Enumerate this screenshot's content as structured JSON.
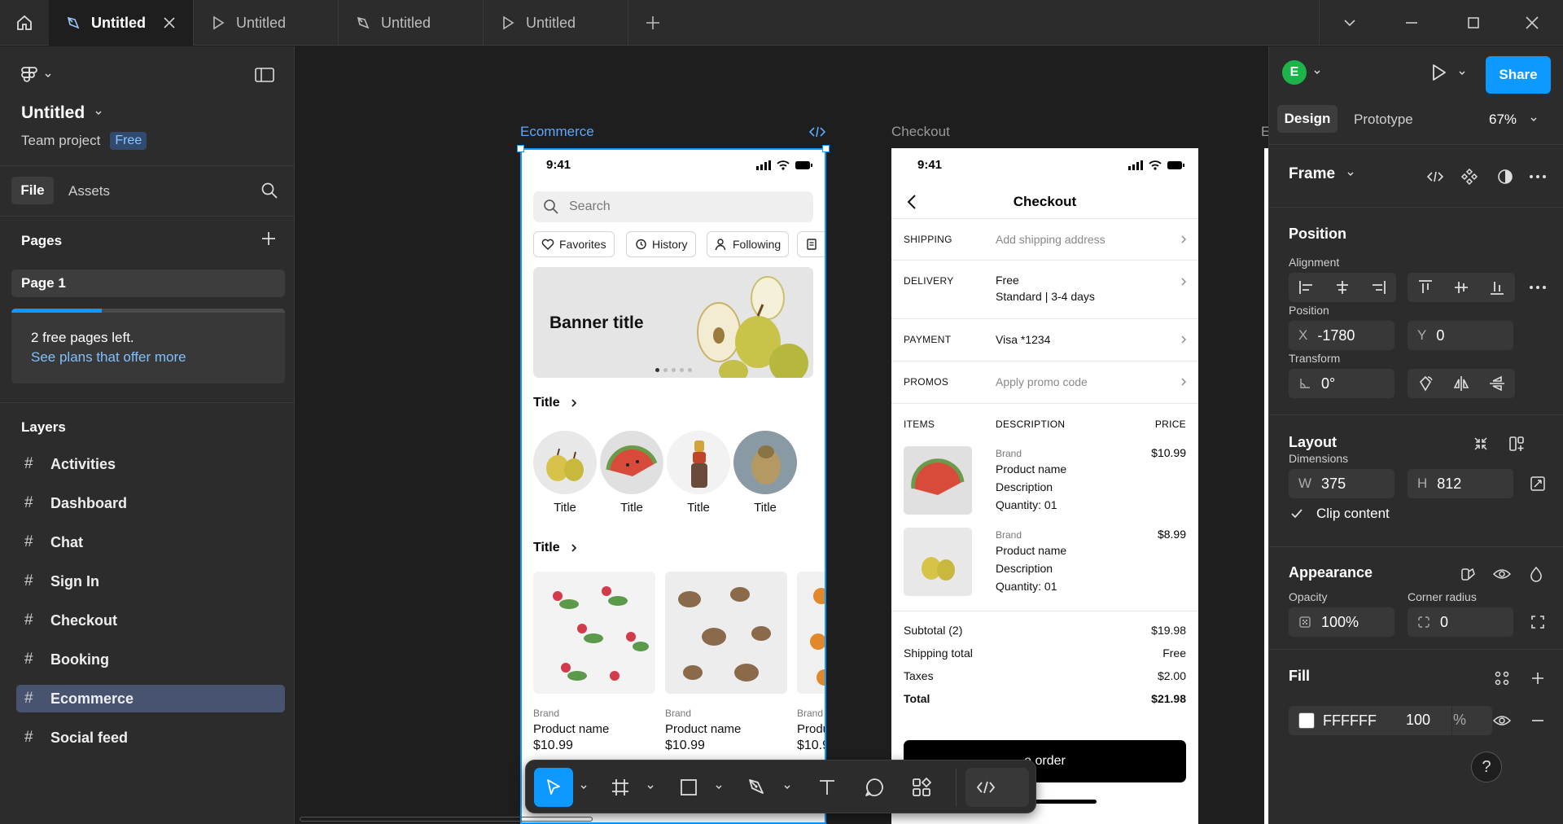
{
  "tabs": [
    {
      "label": "Untitled",
      "icon": "design-file-icon",
      "active": true
    },
    {
      "label": "Untitled",
      "icon": "play-file-icon"
    },
    {
      "label": "Untitled",
      "icon": "design-file-icon"
    },
    {
      "label": "Untitled",
      "icon": "play-file-icon"
    }
  ],
  "file": {
    "title": "Untitled",
    "project": "Team project",
    "plan_badge": "Free"
  },
  "panel_tabs": {
    "file": "File",
    "assets": "Assets"
  },
  "pages": {
    "heading": "Pages",
    "items": [
      "Page 1"
    ],
    "notice": "2 free pages left.",
    "notice_link": "See plans that offer more",
    "usage_fraction": 0.33
  },
  "layers": {
    "heading": "Layers",
    "items": [
      "Activities",
      "Dashboard",
      "Chat",
      "Sign In",
      "Checkout",
      "Booking",
      "Ecommerce",
      "Social feed"
    ],
    "selected": "Ecommerce"
  },
  "canvas": {
    "ecommerce": {
      "label": "Ecommerce",
      "time": "9:41",
      "search_placeholder": "Search",
      "chips": [
        "Favorites",
        "History",
        "Following"
      ],
      "banner_title": "Banner title",
      "section1_title": "Title",
      "circles": [
        "Title",
        "Title",
        "Title",
        "Title"
      ],
      "section2_title": "Title",
      "products": [
        {
          "brand": "Brand",
          "name": "Product name",
          "price": "$10.99"
        },
        {
          "brand": "Brand",
          "name": "Product name",
          "price": "$10.99"
        },
        {
          "brand": "Brand",
          "name": "Produ",
          "price": "$10.9"
        }
      ]
    },
    "checkout": {
      "label": "Checkout",
      "time": "9:41",
      "title": "Checkout",
      "shipping": {
        "key": "SHIPPING",
        "value": "Add shipping address"
      },
      "delivery": {
        "key": "DELIVERY",
        "value1": "Free",
        "value2": "Standard | 3-4 days"
      },
      "payment": {
        "key": "PAYMENT",
        "value": "Visa *1234"
      },
      "promos": {
        "key": "PROMOS",
        "value": "Apply promo code"
      },
      "items_header": {
        "items": "ITEMS",
        "description": "DESCRIPTION",
        "price": "PRICE"
      },
      "items": [
        {
          "brand": "Brand",
          "name": "Product name",
          "desc": "Description",
          "qty": "Quantity: 01",
          "price": "$10.99"
        },
        {
          "brand": "Brand",
          "name": "Product name",
          "desc": "Description",
          "qty": "Quantity: 01",
          "price": "$8.99"
        }
      ],
      "summary": [
        {
          "label": "Subtotal (2)",
          "value": "$19.98"
        },
        {
          "label": "Shipping total",
          "value": "Free"
        },
        {
          "label": "Taxes",
          "value": "$2.00"
        },
        {
          "label": "Total",
          "value": "$21.98"
        }
      ],
      "cta": "e order"
    }
  },
  "right": {
    "avatar_letter": "E",
    "avatar_color": "#1bb34a",
    "share": "Share",
    "tabs": {
      "design": "Design",
      "prototype": "Prototype"
    },
    "zoom": "67%",
    "frame_label": "Frame",
    "position_heading": "Position",
    "alignment_label": "Alignment",
    "position_label": "Position",
    "x_label": "X",
    "x_value": "-1780",
    "y_label": "Y",
    "y_value": "0",
    "transform_label": "Transform",
    "rotation": "0°",
    "layout_heading": "Layout",
    "dimensions_label": "Dimensions",
    "w_label": "W",
    "w_value": "375",
    "h_label": "H",
    "h_value": "812",
    "clip_content": "Clip content",
    "appearance_heading": "Appearance",
    "opacity_label": "Opacity",
    "opacity_value": "100%",
    "radius_label": "Corner radius",
    "radius_value": "0",
    "fill_heading": "Fill",
    "fill_hex": "FFFFFF",
    "fill_opacity": "100",
    "fill_pct": "%",
    "help": "?"
  },
  "colors": {
    "accent": "#0d99ff",
    "selection": "#485370",
    "panel": "#2c2c2c",
    "canvas": "#1e1e1e"
  }
}
